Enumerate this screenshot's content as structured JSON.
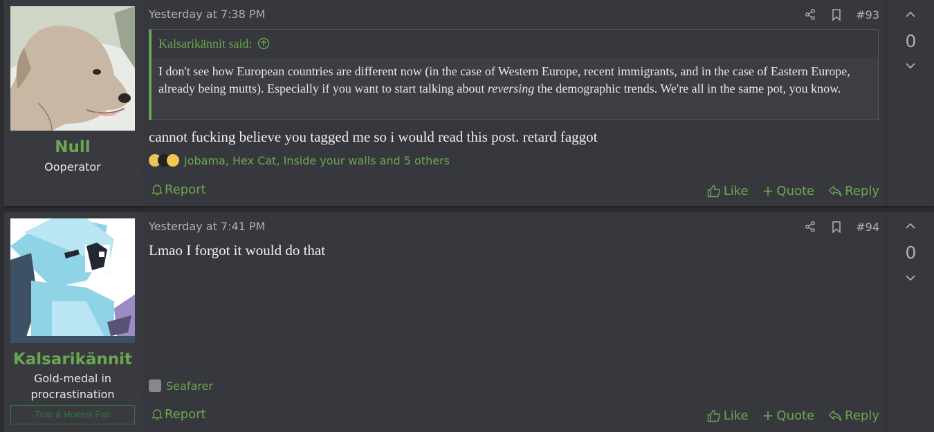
{
  "posts": [
    {
      "username": "Null",
      "user_title": "Ooperator",
      "date": "Yesterday at 7:38 PM",
      "post_number": "#93",
      "quote": {
        "author_said": "Kalsarikännit said:",
        "text_before": "I don't see how European countries are different now (in the case of Western Europe, recent immigrants, and in the case of Eastern Europe, already being mutts). Especially if you want to start talking about ",
        "text_em": "reversing",
        "text_after": " the demographic trends. We're all in the same pot, you know."
      },
      "message": "cannot fucking believe you tagged me so i would read this post. retard faggot",
      "reactions_text": "Jobama, Hex Cat, Inside your walls and 5 others",
      "score": "0"
    },
    {
      "username": "Kalsarikännit",
      "user_title_line1": "Gold-medal in",
      "user_title_line2": "procrastination",
      "user_banner": "True & Honest Fan",
      "date": "Yesterday at 7:41 PM",
      "post_number": "#94",
      "message": "Lmao I forgot it would do that",
      "reactions_text": "Seafarer",
      "score": "0"
    }
  ],
  "actions": {
    "report": "Report",
    "like": "Like",
    "quote": "Quote",
    "reply": "Reply"
  },
  "colors": {
    "accent": "#6aa84f",
    "background": "#2b2d31",
    "post_bg": "#383a3f",
    "banner": "#2e7d32"
  },
  "icons": [
    "share-icon",
    "bookmark-icon",
    "chevron-up-icon",
    "chevron-down-icon",
    "bell-icon",
    "thumbs-up-icon",
    "plus-icon",
    "reply-icon",
    "arrow-up-circle-icon"
  ]
}
